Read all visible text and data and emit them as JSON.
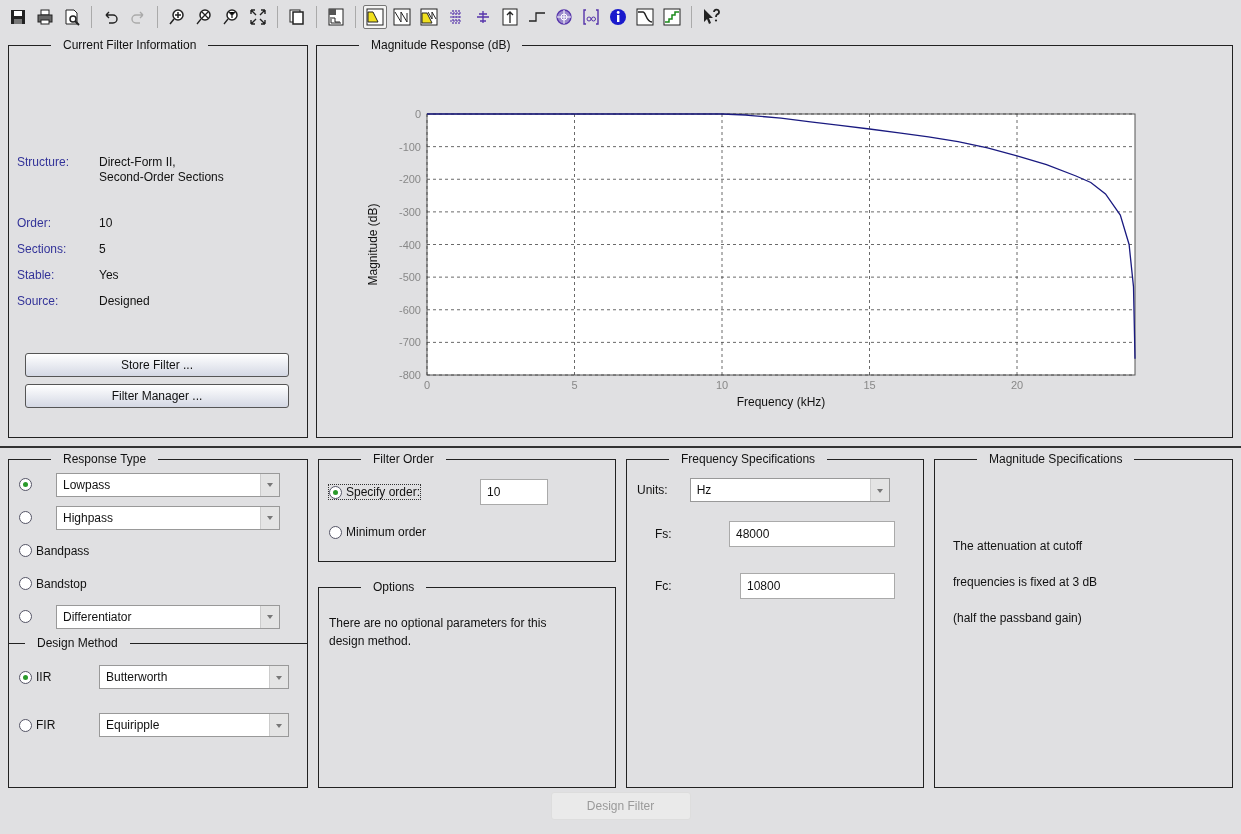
{
  "toolbar": [
    [
      {
        "kind": "save"
      },
      {
        "kind": "print"
      },
      {
        "kind": "print-preview"
      }
    ],
    [
      {
        "kind": "undo",
        "disabled": false
      },
      {
        "kind": "redo",
        "disabled": true
      }
    ],
    [
      {
        "kind": "zoom-in"
      },
      {
        "kind": "zoom-x"
      },
      {
        "kind": "zoom-y"
      },
      {
        "kind": "full-view"
      }
    ],
    [
      {
        "kind": "new-window"
      }
    ],
    [
      {
        "kind": "designer"
      }
    ],
    [
      {
        "kind": "magnitude",
        "selected": true
      },
      {
        "kind": "phase",
        "selected": false
      },
      {
        "kind": "mag-phase",
        "selected": false
      },
      {
        "kind": "group-delay",
        "selected": false
      },
      {
        "kind": "phase-delay",
        "selected": false
      },
      {
        "kind": "impulse",
        "selected": false
      },
      {
        "kind": "step",
        "selected": false
      },
      {
        "kind": "pole-zero",
        "selected": false
      },
      {
        "kind": "coefficients",
        "selected": false
      },
      {
        "kind": "info",
        "selected": false
      },
      {
        "kind": "magnitude-estimate",
        "selected": false
      },
      {
        "kind": "noise-power",
        "selected": false
      }
    ],
    [
      {
        "kind": "whats-this"
      }
    ]
  ],
  "filter_info": {
    "title": "Current Filter Information",
    "rows": [
      {
        "label": "Structure:",
        "value": "Direct-Form II,\nSecond-Order Sections"
      },
      {
        "label": "Order:",
        "value": "10"
      },
      {
        "label": "Sections:",
        "value": "5"
      },
      {
        "label": "Stable:",
        "value": "Yes"
      },
      {
        "label": "Source:",
        "value": "Designed"
      }
    ],
    "buttons": [
      {
        "label": "Store Filter ..."
      },
      {
        "label": "Filter Manager ..."
      }
    ]
  },
  "magnitude_response": {
    "title": "Magnitude Response (dB)",
    "chart_data": {
      "type": "line",
      "xlabel": "Frequency (kHz)",
      "ylabel": "Magnitude (dB)",
      "x": [
        0,
        2,
        4,
        6,
        8,
        10,
        10.8,
        11,
        12,
        13,
        14,
        15,
        16,
        17,
        18,
        19,
        20,
        21,
        22,
        22.5,
        23,
        23.5,
        23.8,
        23.95,
        24
      ],
      "series": [
        {
          "color": "#1a1a80",
          "values": [
            0,
            0,
            0,
            0,
            0,
            0,
            -3,
            -5,
            -13,
            -24,
            -35,
            -46,
            -58,
            -70,
            -85,
            -104,
            -128,
            -155,
            -190,
            -210,
            -245,
            -310,
            -400,
            -530,
            -750
          ]
        }
      ],
      "grid": true,
      "xlim": [
        0,
        24
      ],
      "ylim": [
        -800,
        0
      ],
      "xticks": [
        0,
        5,
        10,
        15,
        20
      ],
      "yticks": [
        0,
        -100,
        -200,
        -300,
        -400,
        -500,
        -600,
        -700,
        -800
      ]
    }
  },
  "response_type": {
    "title": "Response Type",
    "options": [
      {
        "kind": "dropdown",
        "value": "Lowpass",
        "selected": true
      },
      {
        "kind": "dropdown",
        "value": "Highpass",
        "selected": false
      },
      {
        "kind": "plain",
        "label": "Bandpass",
        "selected": false
      },
      {
        "kind": "plain",
        "label": "Bandstop",
        "selected": false
      },
      {
        "kind": "dropdown",
        "value": "Differentiator",
        "selected": false
      }
    ]
  },
  "design_method": {
    "title": "Design Method",
    "options": [
      {
        "label": "IIR",
        "value": "Butterworth",
        "selected": true
      },
      {
        "label": "FIR",
        "value": "Equiripple",
        "selected": false
      }
    ]
  },
  "filter_order": {
    "title": "Filter Order",
    "options": [
      {
        "kind": "input",
        "label": "Specify order:",
        "value": "10",
        "selected": true,
        "focused": true
      },
      {
        "kind": "plain",
        "label": "Minimum order",
        "selected": false,
        "focused": false
      }
    ]
  },
  "options": {
    "title": "Options",
    "text": "There are no optional parameters for this design method."
  },
  "frequency_specifications": {
    "title": "Frequency Specifications",
    "units": {
      "label": "Units:",
      "value": "Hz"
    },
    "fields": [
      {
        "label": "Fs:",
        "value": "48000"
      },
      {
        "label": "Fc:",
        "value": "10800"
      }
    ]
  },
  "magnitude_specifications": {
    "title": "Magnitude Specifications",
    "text": "The attenuation at cutoff\nfrequencies is fixed at 3 dB\n(half the passband gain)"
  },
  "design_button": {
    "label": "Design Filter",
    "disabled": true
  }
}
